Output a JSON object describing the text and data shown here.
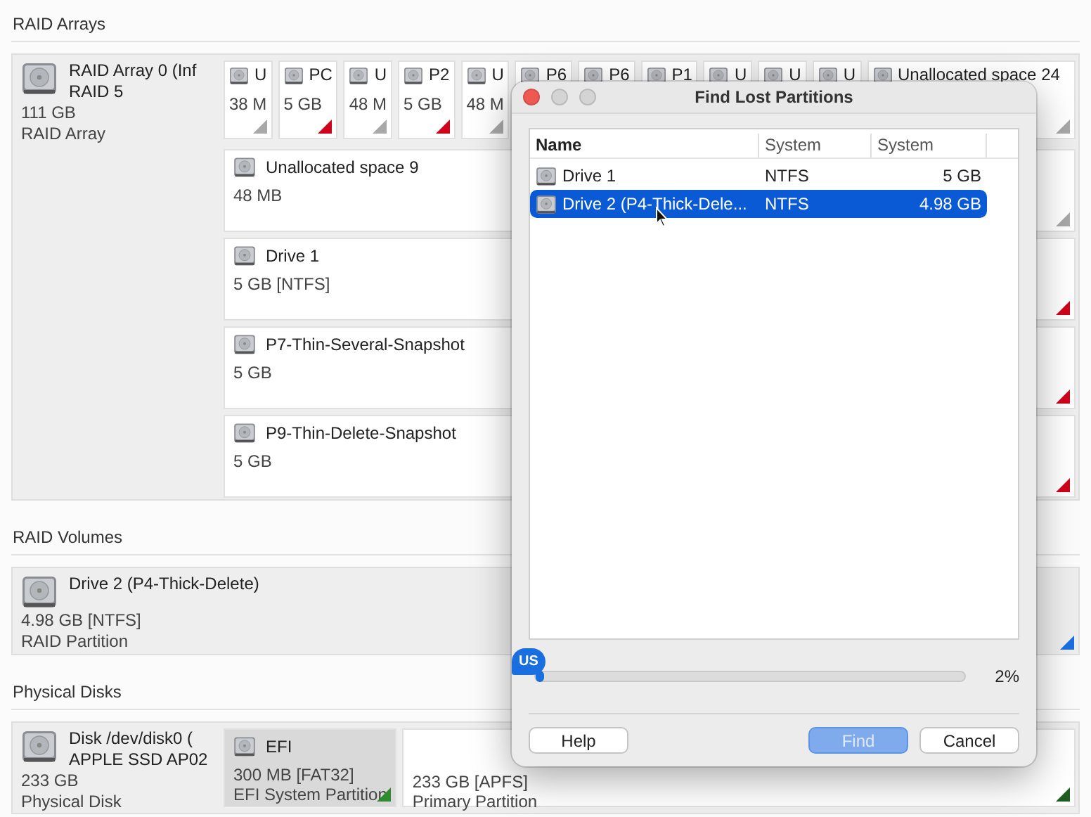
{
  "raid_arrays": {
    "title": "RAID Arrays",
    "device": {
      "name": "RAID Array 0 (Inf",
      "model": "RAID 5",
      "size": "111 GB",
      "type": "RAID Array"
    },
    "tiles": [
      {
        "name": "U",
        "size": "38 M",
        "color": "#a8a8a8"
      },
      {
        "name": "PC",
        "size": "5 GB",
        "color": "#d0021b"
      },
      {
        "name": "U",
        "size": "48 M",
        "color": "#a8a8a8"
      },
      {
        "name": "P2",
        "size": "5 GB",
        "color": "#d0021b"
      },
      {
        "name": "U",
        "size": "48 M",
        "color": "#a8a8a8"
      },
      {
        "name": "P6"
      },
      {
        "name": "P6"
      },
      {
        "name": "P1"
      },
      {
        "name": "U"
      },
      {
        "name": "U"
      },
      {
        "name": "U"
      },
      {
        "name": "Unallocated space 24",
        "color": "#a8a8a8"
      }
    ],
    "partitions": [
      {
        "name": "Unallocated space 9",
        "size": "48 MB",
        "color": "#a8a8a8"
      },
      {
        "name": "Drive 1",
        "size": "5 GB [NTFS]",
        "color": "#d0021b"
      },
      {
        "name": "P7-Thin-Several-Snapshot",
        "size": "5 GB",
        "color": "#d0021b"
      },
      {
        "name": "P9-Thin-Delete-Snapshot",
        "size": "5 GB",
        "color": "#d0021b"
      }
    ]
  },
  "raid_volumes": {
    "title": "RAID Volumes",
    "device": {
      "name": "Drive 2 (P4-Thick-Delete)",
      "size": "4.98 GB [NTFS]",
      "type": "RAID Partition",
      "color": "#1a6fe0"
    }
  },
  "physical_disks": {
    "title": "Physical Disks",
    "device": {
      "name": "Disk /dev/disk0 (",
      "model": "APPLE SSD AP02",
      "size": "233 GB",
      "type": "Physical Disk"
    },
    "partitions": [
      {
        "name": "EFI",
        "size": "300 MB [FAT32]",
        "type": "EFI System Partition",
        "color": "#2e8b2e",
        "selected": true
      },
      {
        "size": "233 GB [APFS]",
        "type": "Primary Partition",
        "color": "#1f5c1f",
        "selected": false
      }
    ]
  },
  "dialog": {
    "title": "Find Lost Partitions",
    "columns": [
      "Name",
      "System",
      "System"
    ],
    "rows": [
      {
        "cells": [
          "Drive 1",
          "NTFS",
          "5 GB"
        ],
        "selected": false
      },
      {
        "cells": [
          "Drive 2 (P4-Thick-Dele...",
          "NTFS",
          "4.98 GB"
        ],
        "selected": true
      }
    ],
    "progress": {
      "badge": "US",
      "level": 0.02,
      "reading": "2%"
    },
    "buttons": [
      {
        "label": "Help",
        "kind": "plain",
        "disabled": false
      },
      {
        "label": "Find",
        "kind": "default",
        "disabled": true
      },
      {
        "label": "Cancel",
        "kind": "plain",
        "disabled": false
      }
    ]
  }
}
